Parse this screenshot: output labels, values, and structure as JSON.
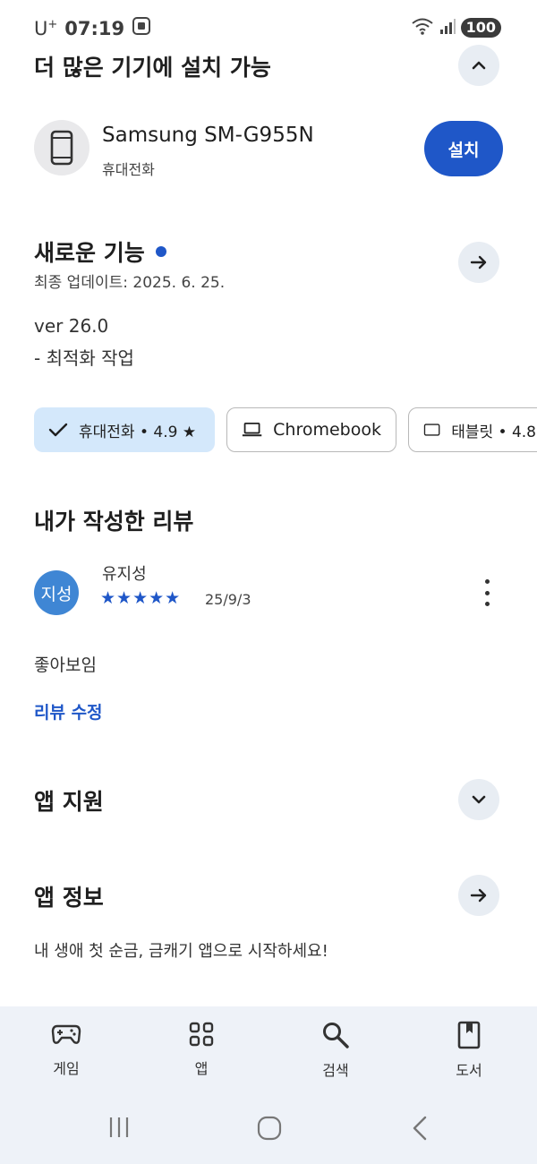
{
  "status_bar": {
    "carrier": "U",
    "carrier_sup": "+",
    "time": "07:19",
    "battery": "100"
  },
  "install_section": {
    "title": "더 많은 기기에 설치 가능",
    "device_name": "Samsung SM-G955N",
    "device_type": "휴대전화",
    "install_label": "설치"
  },
  "whats_new": {
    "title": "새로운 기능",
    "last_updated": "최종 업데이트: 2025. 6. 25.",
    "version": "ver 26.0",
    "note": "- 최적화 작업"
  },
  "device_chips": [
    {
      "label": "휴대전화 • 4.9 ★",
      "selected": true,
      "icon": "check-icon"
    },
    {
      "label": "Chromebook",
      "selected": false,
      "icon": "laptop-icon"
    },
    {
      "label": "태블릿 • 4.8",
      "selected": false,
      "icon": "tablet-icon"
    }
  ],
  "my_review": {
    "title": "내가 작성한 리뷰",
    "avatar_text": "지성",
    "reviewer": "유지성",
    "stars": "★★★★★",
    "rating": 5,
    "date": "25/9/3",
    "text": "좋아보임",
    "edit_label": "리뷰 수정"
  },
  "app_support": {
    "title": "앱 지원"
  },
  "app_info": {
    "title": "앱 정보",
    "description": "내 생애 첫 순금, 금캐기 앱으로 시작하세요!"
  },
  "bottom_nav": [
    {
      "label": "게임",
      "icon": "gamepad-icon"
    },
    {
      "label": "앱",
      "icon": "apps-grid-icon"
    },
    {
      "label": "검색",
      "icon": "search-icon"
    },
    {
      "label": "도서",
      "icon": "book-icon"
    }
  ],
  "colors": {
    "accent": "#1f57c8",
    "chip_selected_bg": "#d4e8fb",
    "circle_button_bg": "#e8edf3",
    "nav_bg": "#eef2f8",
    "avatar_bg": "#3f86d4"
  }
}
